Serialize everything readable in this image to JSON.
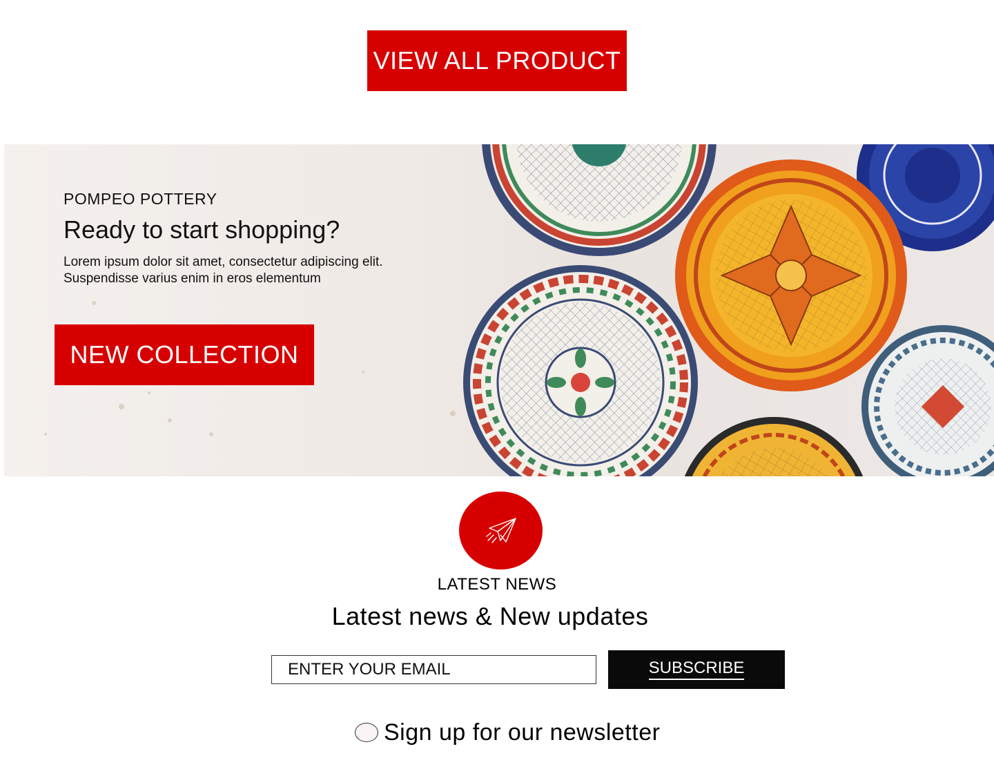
{
  "cta": {
    "view_all_label": "VIEW ALL PRODUCT"
  },
  "hero": {
    "eyebrow": "POMPEO POTTERY",
    "title": "Ready to start shopping?",
    "body": "Lorem ipsum dolor sit amet, consectetur adipiscing elit. Suspendisse varius enim in eros elementum",
    "button_label": "NEW COLLECTION",
    "image_subject": "decorative-ceramic-plates"
  },
  "news": {
    "icon": "paper-plane-icon",
    "eyebrow": "LATEST NEWS",
    "title": "Latest news & New updates",
    "email_placeholder": "ENTER YOUR EMAIL",
    "subscribe_label": "SUBSCRIBE",
    "newsletter_label": "Sign up for our newsletter",
    "newsletter_checked": false
  },
  "colors": {
    "accent": "#d70000",
    "dark": "#0a0a0a",
    "background": "#ffffff"
  }
}
